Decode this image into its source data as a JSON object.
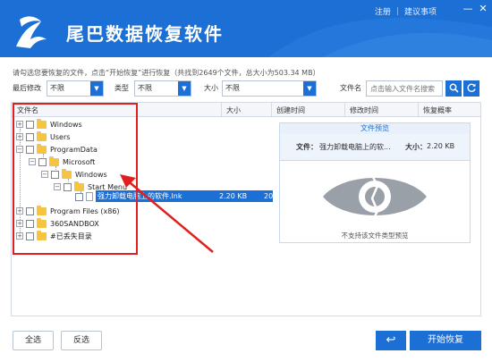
{
  "app": {
    "title": "尾巴数据恢复软件"
  },
  "header_links": {
    "register": "注册",
    "suggest": "建议事项",
    "sep": "|"
  },
  "window_controls": {
    "minimize": "—",
    "close": "✕"
  },
  "info_line": "请勾选您要恢复的文件，点击“开始恢复”进行恢复（共找到2649个文件，总大小为503.34 MB）",
  "filters": {
    "modified_label": "最后修改",
    "modified_value": "不限",
    "type_label": "类型",
    "type_value": "不限",
    "size_label": "大小",
    "size_value": "不限",
    "filename_label": "文件名",
    "search_placeholder": "点击输入文件名搜索"
  },
  "columns": {
    "name": "文件名",
    "size": "大小",
    "created": "创建时间",
    "modified": "修改时间",
    "recovery": "恢复概率"
  },
  "tree": {
    "windows": "Windows",
    "users": "Users",
    "programdata": "ProgramData",
    "microsoft": "Microsoft",
    "windows2": "Windows",
    "start_menu": "Start Menu",
    "file_name": "强力卸载电脑上的软件.lnk",
    "file_size": "2.20 KB",
    "file_created": "20",
    "program_files": "Program Files (x86)",
    "sandbox": "360SANDBOX",
    "lost": "#已丢失目录"
  },
  "preview": {
    "title": "文件预览",
    "file_label": "文件：",
    "file_value": "强力卸载电脑上的软...",
    "size_label": "大小：",
    "size_value": "2.20 KB",
    "message": "不支持该文件类型预览"
  },
  "footer": {
    "select_all": "全选",
    "invert": "反选",
    "back_icon": "↩",
    "start_recovery": "开始恢复"
  },
  "colors": {
    "brand": "#1c6fd4",
    "highlight_box": "#e02020"
  }
}
